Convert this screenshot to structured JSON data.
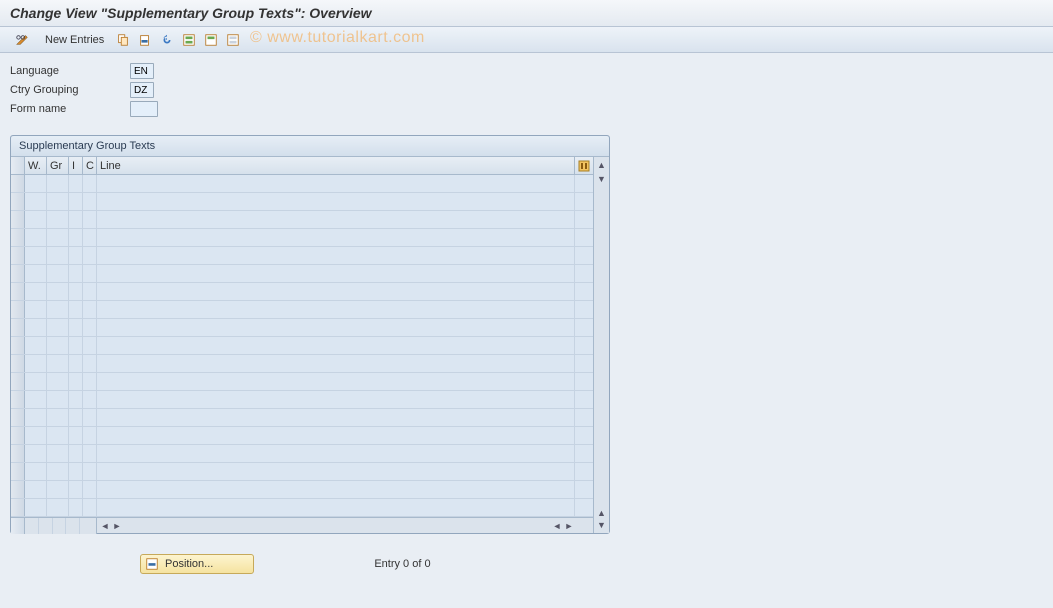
{
  "title": "Change View \"Supplementary Group Texts\": Overview",
  "toolbar": {
    "new_entries_label": "New Entries"
  },
  "watermark": "© www.tutorialkart.com",
  "fields": {
    "language_label": "Language",
    "language_value": "EN",
    "ctry_grouping_label": "Ctry Grouping",
    "ctry_grouping_value": "DZ",
    "form_name_label": "Form name",
    "form_name_value": ""
  },
  "table": {
    "title": "Supplementary Group Texts",
    "columns": {
      "w": "W.",
      "gr": "Gr",
      "i": "I",
      "c": "C",
      "line": "Line"
    }
  },
  "footer": {
    "position_label": "Position...",
    "entry_status": "Entry 0 of 0"
  }
}
